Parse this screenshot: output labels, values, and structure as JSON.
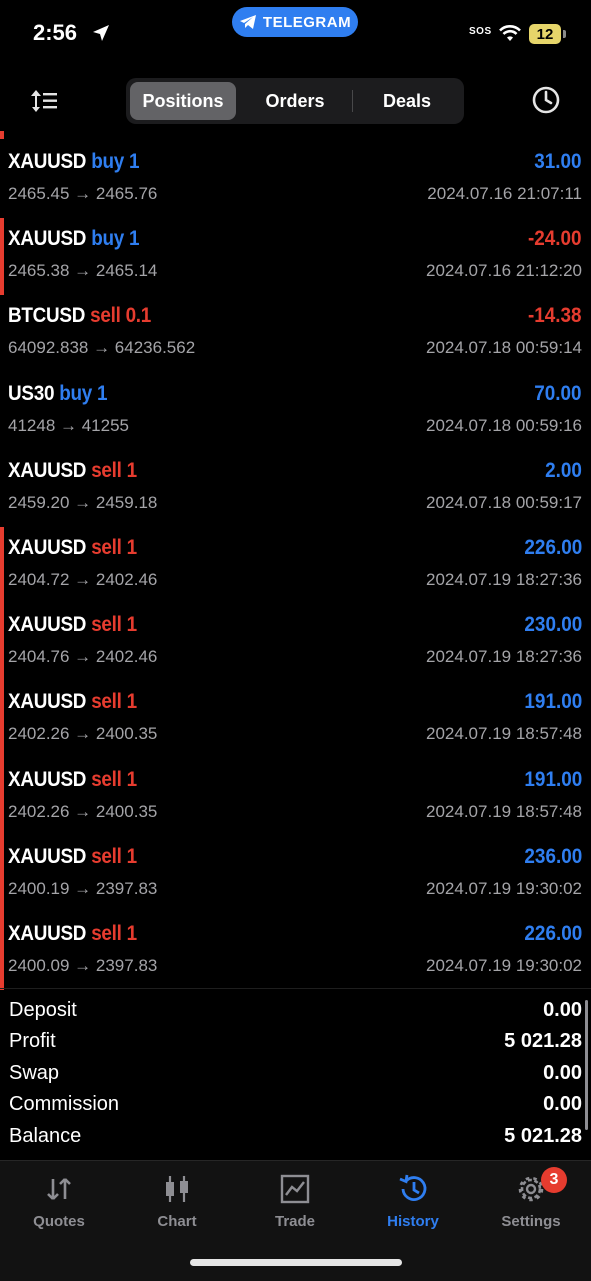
{
  "status_bar": {
    "time": "2:56",
    "telegram_label": "TELEGRAM",
    "sos": "SOS",
    "battery": "12"
  },
  "segments": [
    "Positions",
    "Orders",
    "Deals"
  ],
  "deals": [
    {
      "symbol": "XAUUSD",
      "side": "buy",
      "qty": "1",
      "prices": "2465.45 → 2465.76",
      "profit": "31.00",
      "sign": "pos",
      "time": "2024.07.16 21:07:11",
      "bar": false
    },
    {
      "symbol": "XAUUSD",
      "side": "buy",
      "qty": "1",
      "prices": "2465.38 → 2465.14",
      "profit": "-24.00",
      "sign": "neg",
      "time": "2024.07.16 21:12:20",
      "bar": true
    },
    {
      "symbol": "BTCUSD",
      "side": "sell",
      "qty": "0.1",
      "prices": "64092.838 → 64236.562",
      "profit": "-14.38",
      "sign": "neg",
      "time": "2024.07.18 00:59:14",
      "bar": false
    },
    {
      "symbol": "US30",
      "side": "buy",
      "qty": "1",
      "prices": "41248 → 41255",
      "profit": "70.00",
      "sign": "pos",
      "time": "2024.07.18 00:59:16",
      "bar": false
    },
    {
      "symbol": "XAUUSD",
      "side": "sell",
      "qty": "1",
      "prices": "2459.20 → 2459.18",
      "profit": "2.00",
      "sign": "pos",
      "time": "2024.07.18 00:59:17",
      "bar": false
    },
    {
      "symbol": "XAUUSD",
      "side": "sell",
      "qty": "1",
      "prices": "2404.72 → 2402.46",
      "profit": "226.00",
      "sign": "pos",
      "time": "2024.07.19 18:27:36",
      "bar": true
    },
    {
      "symbol": "XAUUSD",
      "side": "sell",
      "qty": "1",
      "prices": "2404.76 → 2402.46",
      "profit": "230.00",
      "sign": "pos",
      "time": "2024.07.19 18:27:36",
      "bar": true
    },
    {
      "symbol": "XAUUSD",
      "side": "sell",
      "qty": "1",
      "prices": "2402.26 → 2400.35",
      "profit": "191.00",
      "sign": "pos",
      "time": "2024.07.19 18:57:48",
      "bar": true
    },
    {
      "symbol": "XAUUSD",
      "side": "sell",
      "qty": "1",
      "prices": "2402.26 → 2400.35",
      "profit": "191.00",
      "sign": "pos",
      "time": "2024.07.19 18:57:48",
      "bar": true
    },
    {
      "symbol": "XAUUSD",
      "side": "sell",
      "qty": "1",
      "prices": "2400.19 → 2397.83",
      "profit": "236.00",
      "sign": "pos",
      "time": "2024.07.19 19:30:02",
      "bar": true
    },
    {
      "symbol": "XAUUSD",
      "side": "sell",
      "qty": "1",
      "prices": "2400.09 → 2397.83",
      "profit": "226.00",
      "sign": "pos",
      "time": "2024.07.19 19:30:02",
      "bar": true
    }
  ],
  "summary": [
    {
      "label": "Deposit",
      "value": "0.00"
    },
    {
      "label": "Profit",
      "value": "5 021.28"
    },
    {
      "label": "Swap",
      "value": "0.00"
    },
    {
      "label": "Commission",
      "value": "0.00"
    },
    {
      "label": "Balance",
      "value": "5 021.28"
    }
  ],
  "tabs": [
    {
      "label": "Quotes",
      "icon": "quotes-icon"
    },
    {
      "label": "Chart",
      "icon": "chart-icon"
    },
    {
      "label": "Trade",
      "icon": "trade-icon"
    },
    {
      "label": "History",
      "icon": "history-icon",
      "active": true
    },
    {
      "label": "Settings",
      "icon": "settings-icon",
      "badge": "3"
    }
  ],
  "colors": {
    "accent_blue": "#2f7ef0",
    "loss_red": "#e63c2f",
    "muted": "#a4a4a8"
  }
}
